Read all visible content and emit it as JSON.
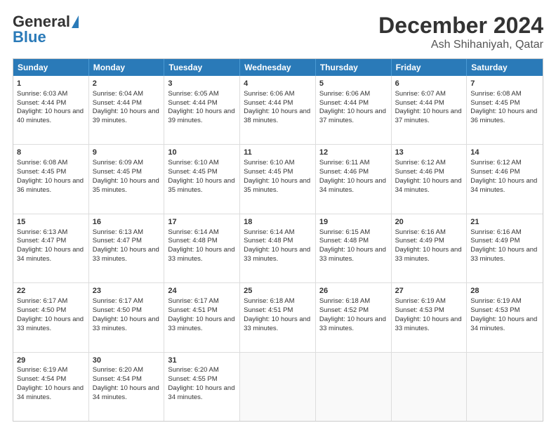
{
  "header": {
    "logo_general": "General",
    "logo_blue": "Blue",
    "month_title": "December 2024",
    "location": "Ash Shihaniyah, Qatar"
  },
  "days_of_week": [
    "Sunday",
    "Monday",
    "Tuesday",
    "Wednesday",
    "Thursday",
    "Friday",
    "Saturday"
  ],
  "weeks": [
    [
      {
        "day": 1,
        "sunrise": "6:03 AM",
        "sunset": "4:44 PM",
        "daylight": "10 hours and 40 minutes."
      },
      {
        "day": 2,
        "sunrise": "6:04 AM",
        "sunset": "4:44 PM",
        "daylight": "10 hours and 39 minutes."
      },
      {
        "day": 3,
        "sunrise": "6:05 AM",
        "sunset": "4:44 PM",
        "daylight": "10 hours and 39 minutes."
      },
      {
        "day": 4,
        "sunrise": "6:06 AM",
        "sunset": "4:44 PM",
        "daylight": "10 hours and 38 minutes."
      },
      {
        "day": 5,
        "sunrise": "6:06 AM",
        "sunset": "4:44 PM",
        "daylight": "10 hours and 37 minutes."
      },
      {
        "day": 6,
        "sunrise": "6:07 AM",
        "sunset": "4:44 PM",
        "daylight": "10 hours and 37 minutes."
      },
      {
        "day": 7,
        "sunrise": "6:08 AM",
        "sunset": "4:45 PM",
        "daylight": "10 hours and 36 minutes."
      }
    ],
    [
      {
        "day": 8,
        "sunrise": "6:08 AM",
        "sunset": "4:45 PM",
        "daylight": "10 hours and 36 minutes."
      },
      {
        "day": 9,
        "sunrise": "6:09 AM",
        "sunset": "4:45 PM",
        "daylight": "10 hours and 35 minutes."
      },
      {
        "day": 10,
        "sunrise": "6:10 AM",
        "sunset": "4:45 PM",
        "daylight": "10 hours and 35 minutes."
      },
      {
        "day": 11,
        "sunrise": "6:10 AM",
        "sunset": "4:45 PM",
        "daylight": "10 hours and 35 minutes."
      },
      {
        "day": 12,
        "sunrise": "6:11 AM",
        "sunset": "4:46 PM",
        "daylight": "10 hours and 34 minutes."
      },
      {
        "day": 13,
        "sunrise": "6:12 AM",
        "sunset": "4:46 PM",
        "daylight": "10 hours and 34 minutes."
      },
      {
        "day": 14,
        "sunrise": "6:12 AM",
        "sunset": "4:46 PM",
        "daylight": "10 hours and 34 minutes."
      }
    ],
    [
      {
        "day": 15,
        "sunrise": "6:13 AM",
        "sunset": "4:47 PM",
        "daylight": "10 hours and 34 minutes."
      },
      {
        "day": 16,
        "sunrise": "6:13 AM",
        "sunset": "4:47 PM",
        "daylight": "10 hours and 33 minutes."
      },
      {
        "day": 17,
        "sunrise": "6:14 AM",
        "sunset": "4:48 PM",
        "daylight": "10 hours and 33 minutes."
      },
      {
        "day": 18,
        "sunrise": "6:14 AM",
        "sunset": "4:48 PM",
        "daylight": "10 hours and 33 minutes."
      },
      {
        "day": 19,
        "sunrise": "6:15 AM",
        "sunset": "4:48 PM",
        "daylight": "10 hours and 33 minutes."
      },
      {
        "day": 20,
        "sunrise": "6:16 AM",
        "sunset": "4:49 PM",
        "daylight": "10 hours and 33 minutes."
      },
      {
        "day": 21,
        "sunrise": "6:16 AM",
        "sunset": "4:49 PM",
        "daylight": "10 hours and 33 minutes."
      }
    ],
    [
      {
        "day": 22,
        "sunrise": "6:17 AM",
        "sunset": "4:50 PM",
        "daylight": "10 hours and 33 minutes."
      },
      {
        "day": 23,
        "sunrise": "6:17 AM",
        "sunset": "4:50 PM",
        "daylight": "10 hours and 33 minutes."
      },
      {
        "day": 24,
        "sunrise": "6:17 AM",
        "sunset": "4:51 PM",
        "daylight": "10 hours and 33 minutes."
      },
      {
        "day": 25,
        "sunrise": "6:18 AM",
        "sunset": "4:51 PM",
        "daylight": "10 hours and 33 minutes."
      },
      {
        "day": 26,
        "sunrise": "6:18 AM",
        "sunset": "4:52 PM",
        "daylight": "10 hours and 33 minutes."
      },
      {
        "day": 27,
        "sunrise": "6:19 AM",
        "sunset": "4:53 PM",
        "daylight": "10 hours and 33 minutes."
      },
      {
        "day": 28,
        "sunrise": "6:19 AM",
        "sunset": "4:53 PM",
        "daylight": "10 hours and 34 minutes."
      }
    ],
    [
      {
        "day": 29,
        "sunrise": "6:19 AM",
        "sunset": "4:54 PM",
        "daylight": "10 hours and 34 minutes."
      },
      {
        "day": 30,
        "sunrise": "6:20 AM",
        "sunset": "4:54 PM",
        "daylight": "10 hours and 34 minutes."
      },
      {
        "day": 31,
        "sunrise": "6:20 AM",
        "sunset": "4:55 PM",
        "daylight": "10 hours and 34 minutes."
      },
      null,
      null,
      null,
      null
    ]
  ]
}
